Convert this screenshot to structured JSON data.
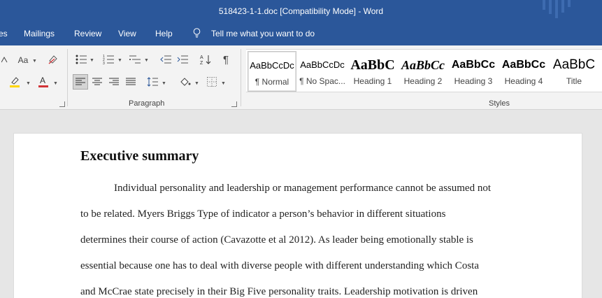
{
  "window": {
    "title": "518423-1-1.doc [Compatibility Mode]  -  Word"
  },
  "menu": {
    "items": [
      "es",
      "Mailings",
      "Review",
      "View",
      "Help"
    ],
    "tell_me": "Tell me what you want to do"
  },
  "ribbon": {
    "paragraph_label": "Paragraph",
    "styles_label": "Styles",
    "font_size_button": "Aa",
    "styles": [
      {
        "sample": "AaBbCcDc",
        "name": "¶ Normal",
        "selected": true
      },
      {
        "sample": "AaBbCcDc",
        "name": "¶ No Spac...",
        "selected": false
      },
      {
        "sample": "AaBbC",
        "name": "Heading 1",
        "selected": false
      },
      {
        "sample": "AaBbCc",
        "name": "Heading 2",
        "selected": false
      },
      {
        "sample": "AaBbCc",
        "name": "Heading 3",
        "selected": false
      },
      {
        "sample": "AaBbCc",
        "name": "Heading 4",
        "selected": false
      },
      {
        "sample": "AaBbC",
        "name": "Title",
        "selected": false
      }
    ]
  },
  "document": {
    "heading": "Executive summary",
    "lines": [
      "Individual personality and leadership or management performance cannot be assumed not",
      "to be related. Myers Briggs Type of indicator a person’s behavior in different situations",
      "determines their course of action (Cavazotte et al 2012). As leader being emotionally stable is",
      "essential because one has to deal with diverse people with different understanding which Costa",
      "and McCrae state precisely in their Big Five personality traits. Leadership motivation is driven"
    ]
  },
  "colors": {
    "titlebar": "#2b579a",
    "ribbon": "#f3f3f3",
    "canvas": "#e6e6e6",
    "page": "#ffffff"
  }
}
